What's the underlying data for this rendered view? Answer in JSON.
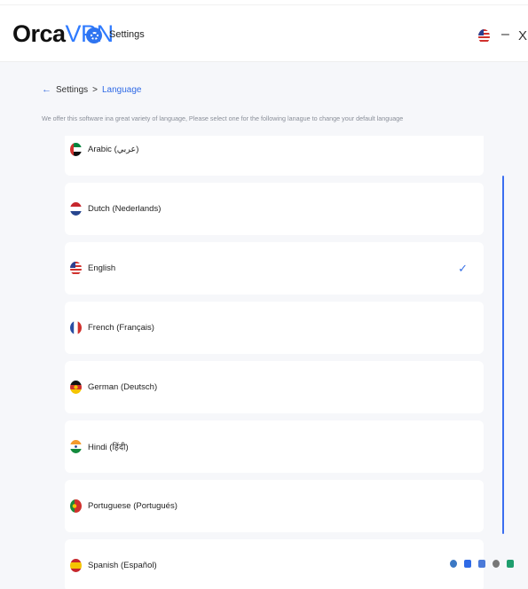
{
  "header": {
    "logo_primary": "Orca",
    "logo_accent": "VPN",
    "title": "Settings",
    "minimize_label": "–",
    "close_label": "X"
  },
  "breadcrumb": {
    "back_icon": "←",
    "parent": "Settings",
    "separator": ">",
    "current": "Language"
  },
  "description": "We offer this software ina great variety of language, Please select one for the following lanague to change your default language",
  "languages": [
    {
      "label": "Arabic (عربي)",
      "flag": "uae-flag-icon",
      "selected": false
    },
    {
      "label": "Dutch (Nederlands)",
      "flag": "netherlands-flag-icon",
      "selected": false
    },
    {
      "label": "English",
      "flag": "us-flag-icon",
      "selected": true
    },
    {
      "label": "French (Français)",
      "flag": "france-flag-icon",
      "selected": false
    },
    {
      "label": "German (Deutsch)",
      "flag": "germany-flag-icon",
      "selected": false
    },
    {
      "label": "Hindi (हिंदी)",
      "flag": "india-flag-icon",
      "selected": false
    },
    {
      "label": "Portuguese (Portugués)",
      "flag": "portugal-flag-icon",
      "selected": false
    },
    {
      "label": "Spanish (Español)",
      "flag": "spain-flag-icon",
      "selected": false
    }
  ],
  "check_mark": "✓",
  "colors": {
    "accent": "#2f6ae6",
    "background": "#f6f7fa",
    "card": "#ffffff",
    "scrollbar": "#3b6ef0"
  }
}
